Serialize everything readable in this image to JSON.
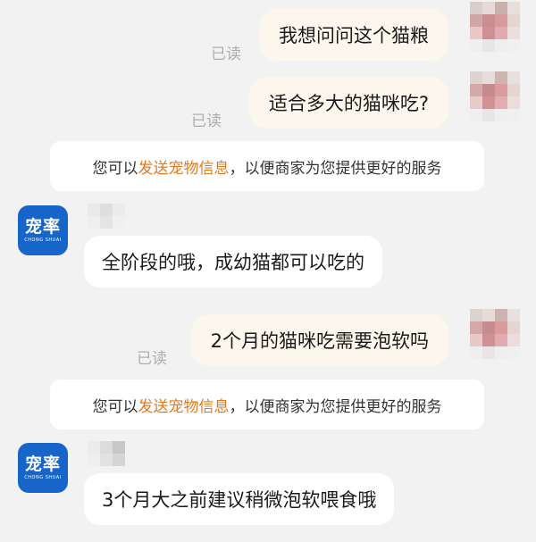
{
  "conversation": {
    "messages": [
      {
        "sender": "user",
        "text": "我想问问这个猫粮",
        "status": "已读"
      },
      {
        "sender": "user",
        "text": "适合多大的猫咪吃?",
        "status": "已读"
      },
      {
        "sender": "system",
        "prefix": "您可以",
        "link": "发送宠物信息",
        "suffix": "，以便商家为您提供更好的服务"
      },
      {
        "sender": "shop",
        "text": "全阶段的哦，成幼猫都可以吃的"
      },
      {
        "sender": "user",
        "text": "2个月的猫咪吃需要泡软吗",
        "status": "已读"
      },
      {
        "sender": "system",
        "prefix": "您可以",
        "link": "发送宠物信息",
        "suffix": "，以便商家为您提供更好的服务"
      },
      {
        "sender": "shop",
        "text": "3个月大之前建议稍微泡软喂食哦"
      }
    ]
  },
  "shop": {
    "logo_text": "宠率",
    "logo_subtext": "CHONG SHUAI"
  },
  "colors": {
    "background": "#f2f2f2",
    "outgoing_bubble": "#fcf7ec",
    "incoming_bubble": "#ffffff",
    "link": "#e07a1f",
    "read_receipt": "#aeaeae",
    "shop_brand": "#1765c9"
  }
}
